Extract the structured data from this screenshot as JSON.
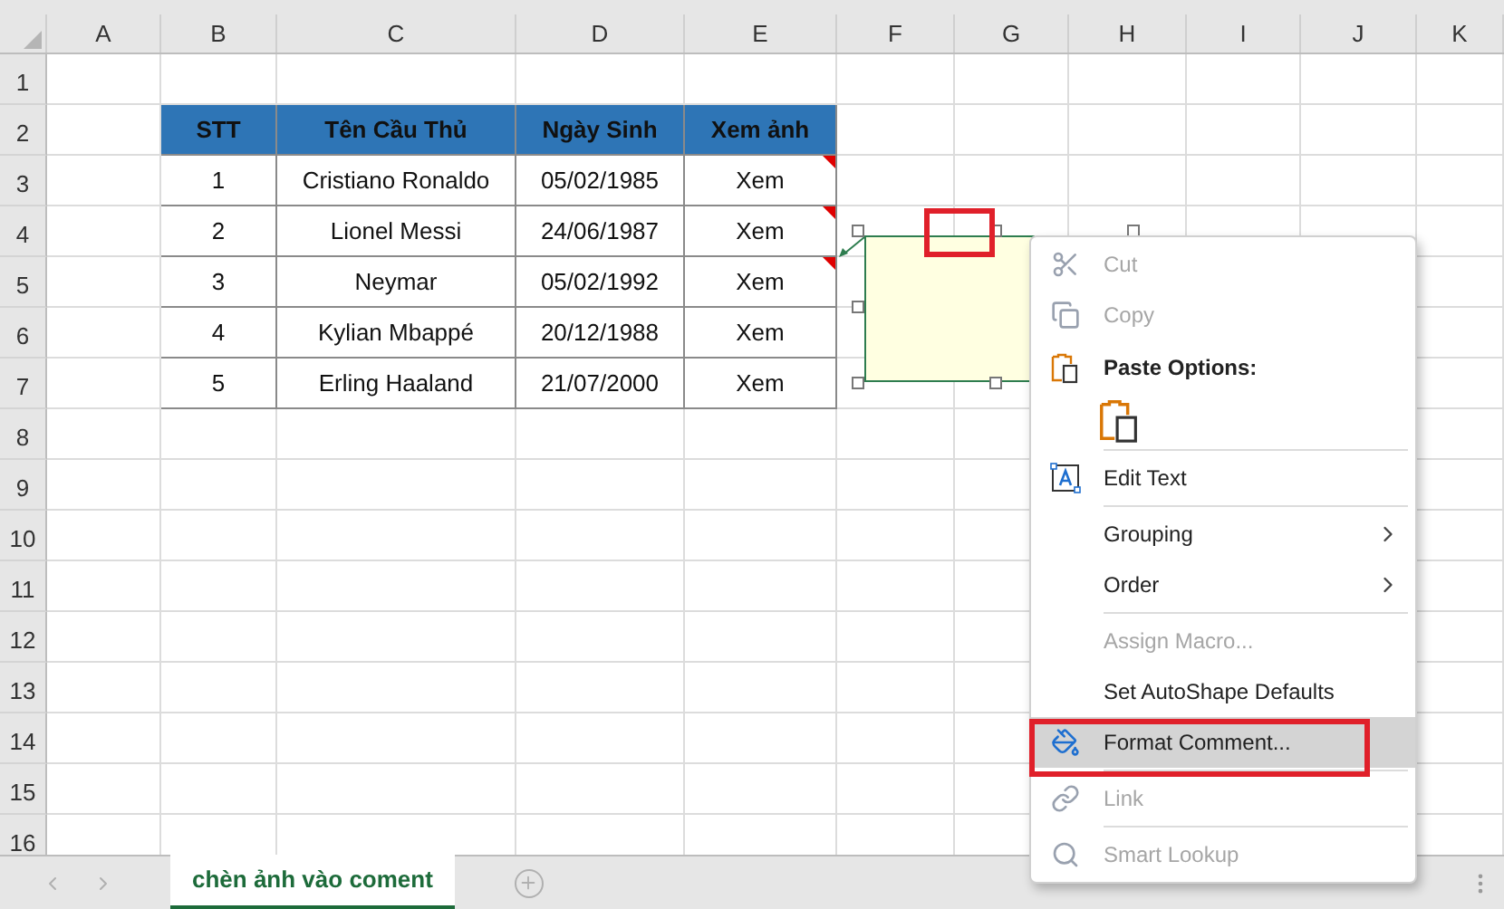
{
  "columns": [
    "A",
    "B",
    "C",
    "D",
    "E",
    "F",
    "G",
    "H",
    "I",
    "J",
    "K"
  ],
  "row_numbers": [
    "1",
    "2",
    "3",
    "4",
    "5",
    "6",
    "7",
    "8",
    "9",
    "10",
    "11",
    "12",
    "13",
    "14",
    "15",
    "16"
  ],
  "table": {
    "header": [
      "STT",
      "Tên Cầu Thủ",
      "Ngày Sinh",
      "Xem ảnh"
    ],
    "rows": [
      {
        "cells": [
          "1",
          "Cristiano Ronaldo",
          "05/02/1985",
          "Xem"
        ],
        "has_comment": true
      },
      {
        "cells": [
          "2",
          "Lionel Messi",
          "24/06/1987",
          "Xem"
        ],
        "has_comment": true
      },
      {
        "cells": [
          "3",
          "Neymar",
          "05/02/1992",
          "Xem"
        ],
        "has_comment": true
      },
      {
        "cells": [
          "4",
          "Kylian Mbappé",
          "20/12/1988",
          "Xem"
        ],
        "has_comment": false
      },
      {
        "cells": [
          "5",
          "Erling Haaland",
          "21/07/2000",
          "Xem"
        ],
        "has_comment": false
      }
    ]
  },
  "context_menu": [
    {
      "kind": "item",
      "label": "Cut",
      "disabled": true,
      "selected": false
    },
    {
      "kind": "item",
      "label": "Copy",
      "disabled": true,
      "selected": false
    },
    {
      "kind": "header",
      "label": "Paste Options:"
    },
    {
      "kind": "paste_button"
    },
    {
      "kind": "separator"
    },
    {
      "kind": "item",
      "label": "Edit Text",
      "disabled": false,
      "selected": false
    },
    {
      "kind": "separator"
    },
    {
      "kind": "submenu",
      "label": "Grouping",
      "disabled": false,
      "selected": false
    },
    {
      "kind": "submenu",
      "label": "Order",
      "disabled": false,
      "selected": false
    },
    {
      "kind": "separator"
    },
    {
      "kind": "item",
      "label": "Assign Macro...",
      "disabled": true,
      "selected": false
    },
    {
      "kind": "item",
      "label": "Set AutoShape Defaults",
      "disabled": false,
      "selected": false
    },
    {
      "kind": "item",
      "label": "Format Comment...",
      "disabled": false,
      "selected": true
    },
    {
      "kind": "separator"
    },
    {
      "kind": "item",
      "label": "Link",
      "disabled": true,
      "selected": false
    },
    {
      "kind": "separator"
    },
    {
      "kind": "item",
      "label": "Smart Lookup",
      "disabled": true,
      "selected": false
    }
  ],
  "sheet_tabs": [
    {
      "label": "chèn ảnh vào coment",
      "selected": true
    }
  ]
}
